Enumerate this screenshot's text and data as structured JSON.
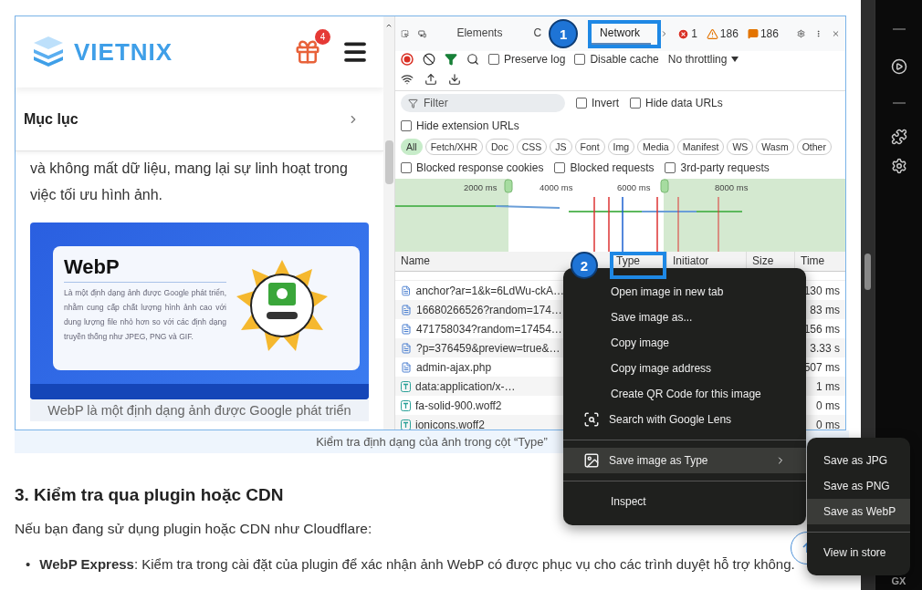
{
  "figure": {
    "mobile_page": {
      "logo": "VIETNIX",
      "gift_badge": "4",
      "toc_title": "Mục lục",
      "paragraph": "và không mất dữ liệu, mang lại sự linh hoạt trong việc tối ưu hình ảnh.",
      "image_card": {
        "title": "WebP",
        "description": "Là một định dạng ảnh được Google phát triển, nhằm cung cấp chất lượng hình ảnh cao với dung lượng file nhỏ hơn so với các định dạng truyền thống như JPEG, PNG và GIF."
      },
      "image_caption": "WebP là một định dạng ảnh được Google phát triển"
    },
    "devtools": {
      "tabs": [
        {
          "label": "Elements",
          "selected": false
        },
        {
          "label": "C",
          "selected": false
        },
        {
          "label": "Network",
          "selected": true
        }
      ],
      "errors": "1",
      "warnings": "186",
      "issues": "186",
      "toolbar_checks": [
        {
          "label": "Preserve log",
          "checked": false
        },
        {
          "label": "Disable cache",
          "checked": false
        }
      ],
      "throttling": "No throttling",
      "filter": {
        "placeholder": "Filter"
      },
      "filter_checks": [
        {
          "label": "Invert",
          "checked": false
        },
        {
          "label": "Hide data URLs",
          "checked": false
        },
        {
          "label": "Hide extension URLs",
          "checked": false
        }
      ],
      "type_chips": [
        {
          "label": "All",
          "selected": true
        },
        {
          "label": "Fetch/XHR",
          "selected": false
        },
        {
          "label": "Doc",
          "selected": false
        },
        {
          "label": "CSS",
          "selected": false
        },
        {
          "label": "JS",
          "selected": false
        },
        {
          "label": "Font",
          "selected": false
        },
        {
          "label": "Img",
          "selected": false
        },
        {
          "label": "Media",
          "selected": false
        },
        {
          "label": "Manifest",
          "selected": false
        },
        {
          "label": "WS",
          "selected": false
        },
        {
          "label": "Wasm",
          "selected": false
        },
        {
          "label": "Other",
          "selected": false
        }
      ],
      "block_checks": [
        {
          "label": "Blocked response cookies",
          "checked": false
        },
        {
          "label": "Blocked requests",
          "checked": false
        },
        {
          "label": "3rd-party requests",
          "checked": false
        }
      ],
      "timeline_ticks": [
        "2000 ms",
        "4000 ms",
        "6000 ms",
        "8000 ms"
      ],
      "columns": [
        "Name",
        "Type",
        "Initiator",
        "Size",
        "Time"
      ],
      "rows": [
        {
          "name": "anchor?ar=1&k=6LdWu-ckA…",
          "kind": "document",
          "time": "130 ms"
        },
        {
          "name": "16680266526?random=174…",
          "kind": "document",
          "time": "83 ms"
        },
        {
          "name": "471758034?random=17454…",
          "kind": "document",
          "time": "156 ms"
        },
        {
          "name": "?p=376459&preview=true&…",
          "kind": "document",
          "time": "3.33 s"
        },
        {
          "name": "admin-ajax.php",
          "kind": "document",
          "time": "507 ms"
        },
        {
          "name": "data:application/x-…",
          "kind": "font",
          "time": "1 ms"
        },
        {
          "name": "fa-solid-900.woff2",
          "kind": "font",
          "time": "0 ms"
        },
        {
          "name": "ionicons.woff2",
          "kind": "font",
          "time": "0 ms"
        }
      ]
    }
  },
  "callouts": [
    {
      "label": "1"
    },
    {
      "label": "2"
    }
  ],
  "context_menu": [
    {
      "kind": "item",
      "label": "Open image in new tab",
      "selected": false
    },
    {
      "kind": "item",
      "label": "Save image as...",
      "selected": false
    },
    {
      "kind": "item",
      "label": "Copy image",
      "selected": false
    },
    {
      "kind": "item",
      "label": "Copy image address",
      "selected": false
    },
    {
      "kind": "item",
      "label": "Create QR Code for this image",
      "selected": false
    },
    {
      "kind": "lens",
      "label": "Search with Google Lens",
      "selected": false
    },
    {
      "kind": "separator"
    },
    {
      "kind": "submenu",
      "label": "Save image as Type",
      "selected": true
    },
    {
      "kind": "separator"
    },
    {
      "kind": "item",
      "label": "Inspect",
      "selected": false
    }
  ],
  "submenu": [
    {
      "kind": "item",
      "label": "Save as JPG",
      "selected": false
    },
    {
      "kind": "item",
      "label": "Save as PNG",
      "selected": false
    },
    {
      "kind": "item",
      "label": "Save as WebP",
      "selected": true
    },
    {
      "kind": "separator"
    },
    {
      "kind": "item",
      "label": "View in store",
      "selected": false
    }
  ],
  "figure_caption": "Kiểm tra định dạng của ảnh trong cột “Type”",
  "heading": "3. Kiểm tra qua plugin hoặc CDN",
  "paragraph": "Nếu bạn đang sử dụng plugin hoặc CDN như Cloudflare:",
  "bullets": [
    {
      "marker": "•",
      "text": "**WebP Express**: Kiểm tra trong cài đặt của plugin để xác nhận ảnh WebP có được phục vụ cho các trình duyệt hỗ trợ không."
    }
  ],
  "sidebar": {
    "badge": "GX"
  }
}
